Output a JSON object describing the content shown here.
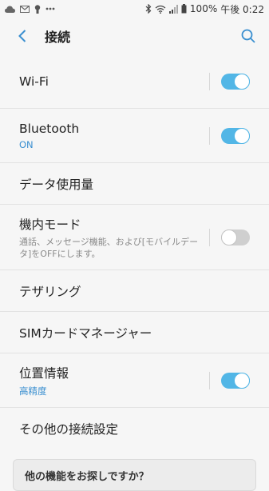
{
  "status_bar": {
    "battery": "100%",
    "time": "午後 0:22"
  },
  "header": {
    "title": "接続"
  },
  "items": [
    {
      "label": "Wi-Fi",
      "toggle": "on"
    },
    {
      "label": "Bluetooth",
      "sub": "ON",
      "toggle": "on"
    },
    {
      "label": "データ使用量"
    },
    {
      "label": "機内モード",
      "desc": "通話、メッセージ機能、および[モバイルデータ]をOFFにします。",
      "toggle": "off"
    },
    {
      "label": "テザリング"
    },
    {
      "label": "SIMカードマネージャー"
    },
    {
      "label": "位置情報",
      "sub": "高精度",
      "toggle": "on"
    },
    {
      "label": "その他の接続設定"
    }
  ],
  "footer_card": {
    "text": "他の機能をお探しですか？"
  },
  "colors": {
    "accent": "#52b6e6",
    "accent_text": "#3a8fd0",
    "background": "#f6f6f6"
  }
}
